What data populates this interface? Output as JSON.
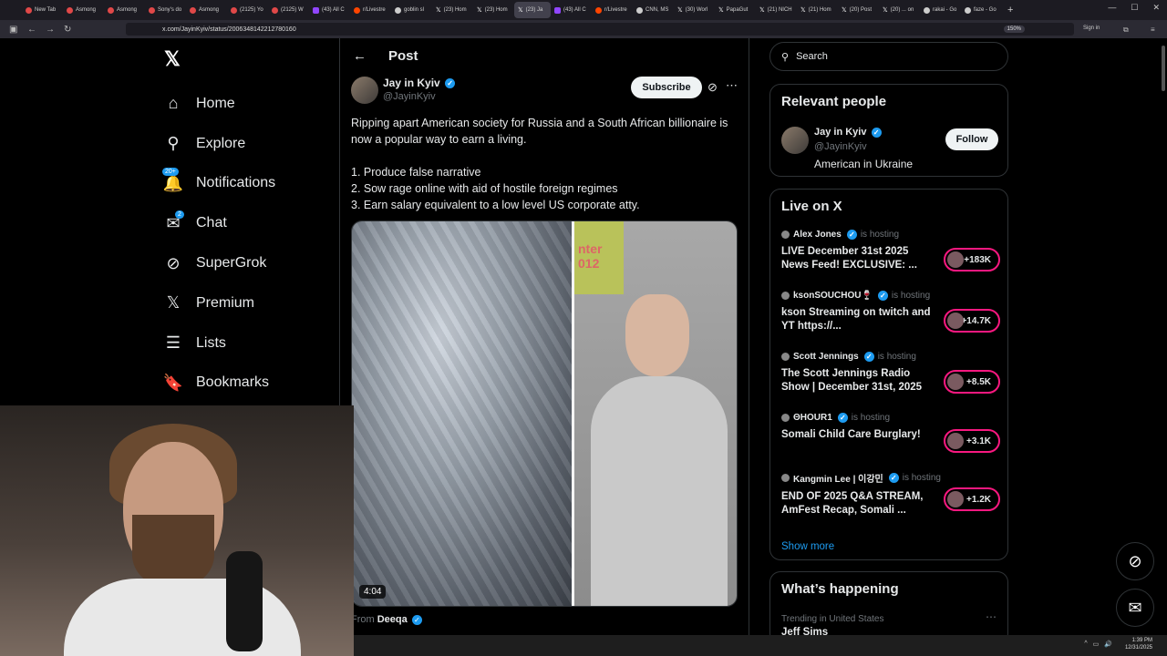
{
  "browser": {
    "tabs": [
      {
        "label": "New Tab",
        "favicon": "red"
      },
      {
        "label": "Asmong",
        "favicon": "red"
      },
      {
        "label": "Asmong",
        "favicon": "red"
      },
      {
        "label": "Sony's do",
        "favicon": "red"
      },
      {
        "label": "Asmong",
        "favicon": "red"
      },
      {
        "label": "(2125) Yo",
        "favicon": "red"
      },
      {
        "label": "(2125) W",
        "favicon": "red"
      },
      {
        "label": "(43) All C",
        "favicon": "purple"
      },
      {
        "label": "r/Livestre",
        "favicon": "orange"
      },
      {
        "label": "goblin sl",
        "favicon": "grey"
      },
      {
        "label": "(23) Hom",
        "favicon": "x"
      },
      {
        "label": "(23) Hom",
        "favicon": "x"
      },
      {
        "label": "(23) Ja",
        "favicon": "x",
        "active": true
      },
      {
        "label": "(43) All C",
        "favicon": "purple"
      },
      {
        "label": "r/Livestre",
        "favicon": "orange"
      },
      {
        "label": "CNN, MS",
        "favicon": "grey"
      },
      {
        "label": "(30) Worl",
        "favicon": "x"
      },
      {
        "label": "PapaGut",
        "favicon": "x"
      },
      {
        "label": "(21) NICH",
        "favicon": "x"
      },
      {
        "label": "(21) Hom",
        "favicon": "x"
      },
      {
        "label": "(20) Post",
        "favicon": "x"
      },
      {
        "label": "(20) ... on",
        "favicon": "x"
      },
      {
        "label": "rakai - Go",
        "favicon": "grey"
      },
      {
        "label": "faze - Go",
        "favicon": "grey"
      }
    ],
    "new_tab": "+",
    "url": "x.com/JayinKyiv/status/2006348142212780160",
    "zoom": "150%",
    "sign_in": "Sign in"
  },
  "sidebar": {
    "items": [
      {
        "label": "Home",
        "icon": "home-icon",
        "glyph": "⌂"
      },
      {
        "label": "Explore",
        "icon": "search-icon",
        "glyph": "⚲"
      },
      {
        "label": "Notifications",
        "icon": "bell-icon",
        "glyph": "🔔",
        "badge": "20+"
      },
      {
        "label": "Chat",
        "icon": "mail-icon",
        "glyph": "✉",
        "badge": "2"
      },
      {
        "label": "SuperGrok",
        "icon": "grok-icon",
        "glyph": "⊘"
      },
      {
        "label": "Premium",
        "icon": "x-logo-icon",
        "glyph": "𝕏"
      },
      {
        "label": "Lists",
        "icon": "list-icon",
        "glyph": "☰"
      },
      {
        "label": "Bookmarks",
        "icon": "bookmark-icon",
        "glyph": "🔖"
      }
    ]
  },
  "post": {
    "header_title": "Post",
    "author_name": "Jay in Kyiv",
    "author_handle": "@JayinKyiv",
    "subscribe_label": "Subscribe",
    "paragraph1": "Ripping apart American society for Russia and a South African billionaire is now a popular way to earn a living.",
    "list": [
      "1. Produce false narrative",
      "2. Sow rage online with aid of hostile foreign regimes",
      "3. Earn salary equivalent to a low level US corporate atty."
    ],
    "video_duration": "4:04",
    "video_sign_text": "nter\n012",
    "from_prefix": "From",
    "from_name": "Deeqa"
  },
  "right": {
    "search_placeholder": "Search",
    "relevant_title": "Relevant people",
    "relevant": {
      "name": "Jay in Kyiv",
      "handle": "@JayinKyiv",
      "bio": "American in Ukraine",
      "follow_label": "Follow"
    },
    "live_title": "Live on X",
    "live": [
      {
        "host": "Alex Jones",
        "status": "is hosting",
        "title": "LIVE December 31st 2025 News Feed! EXCLUSIVE: ...",
        "count": "+183K"
      },
      {
        "host": "ksonSOUCHOU🍷",
        "status": "is hosting",
        "title": "kson Streaming on twitch and YT https://...",
        "count": "+14.7K"
      },
      {
        "host": "Scott Jennings",
        "status": "is hosting",
        "title": "The Scott Jennings Radio Show | December 31st, 2025",
        "count": "+8.5K"
      },
      {
        "host": "ΘHOUR1",
        "status": "is hosting",
        "title": "Somali Child Care Burglary!",
        "count": "+3.1K"
      },
      {
        "host": "Kangmin Lee | 이강민",
        "status": "is hosting",
        "title": "END OF 2025 Q&A STREAM, AmFest Recap, Somali ...",
        "count": "+1.2K"
      }
    ],
    "show_more": "Show more",
    "happening_title": "What’s happening",
    "trending_sub": "Trending in United States",
    "trending_topic": "Jeff Sims"
  },
  "taskbar": {
    "time": "1:39 PM",
    "date": "12/31/2025"
  },
  "colors": {
    "accent": "#1d9bf0",
    "live_ring": "#f91880",
    "background": "#000000",
    "border": "#2f3336"
  }
}
